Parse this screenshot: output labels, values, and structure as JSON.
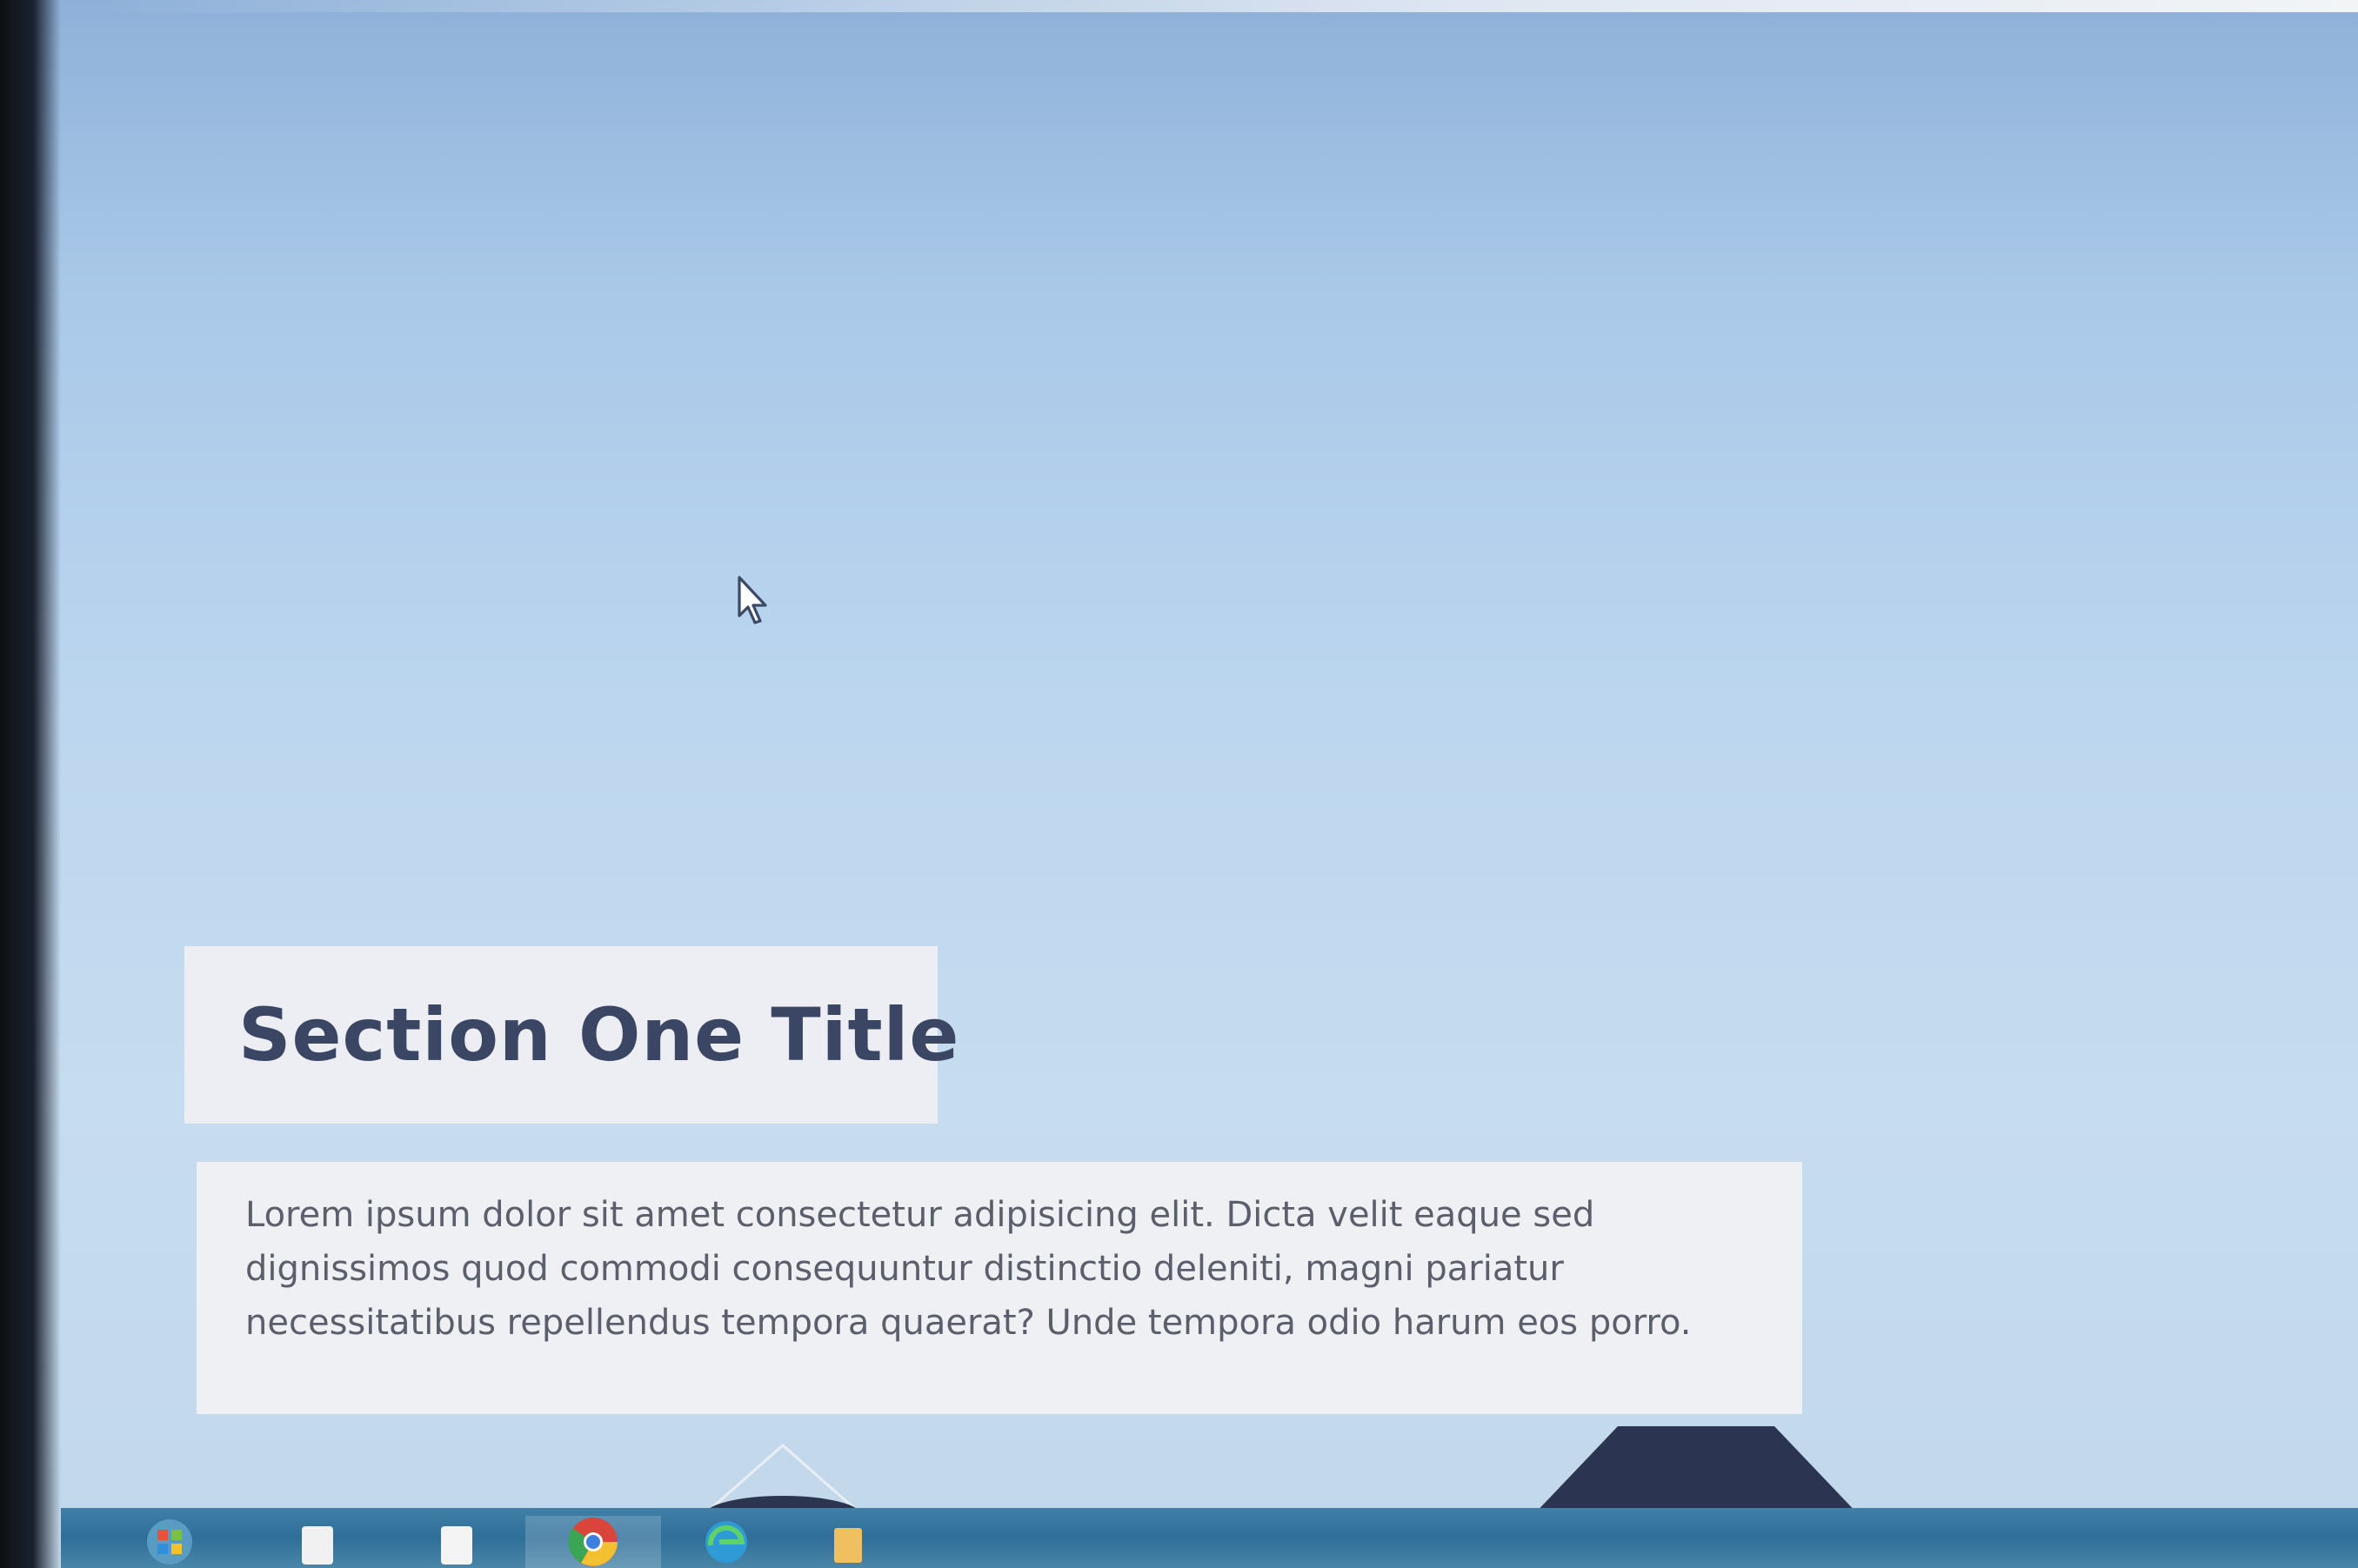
{
  "section": {
    "title": "Section One Title",
    "body": "Lorem ipsum dolor sit amet consectetur adipisicing elit. Dicta velit eaque sed dignissimos quod commodi consequuntur distinctio deleniti, magni pariatur necessitatibus repellendus tempora quaerat? Unde tempora odio harum eos porro."
  },
  "taskbar": {
    "items": [
      {
        "icon": "windows-start-icon"
      },
      {
        "icon": "file-explorer-icon"
      },
      {
        "icon": "document-icon"
      },
      {
        "icon": "chrome-icon"
      },
      {
        "icon": "edge-icon"
      },
      {
        "icon": "app-icon"
      }
    ]
  },
  "colors": {
    "title_text": "#3a4663",
    "body_text": "#5a5f6b",
    "panel_bg": "#eceef3",
    "background_top": "#8fb1d9",
    "background_mid": "#c6dcef",
    "taskbar": "#2f6e98"
  }
}
